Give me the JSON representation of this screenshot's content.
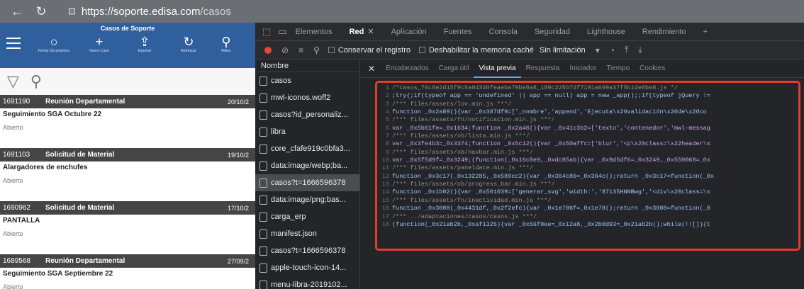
{
  "browser": {
    "url_host": "https://soporte.edisa.com",
    "url_path": "/casos",
    "back_icon": "back-arrow-icon",
    "reload_icon": "reload-icon",
    "lock_icon": "lock-icon"
  },
  "app": {
    "title": "Casos de Soporte",
    "tools": [
      {
        "label": "Firmar Documentos",
        "glyph": "○",
        "icon": "circle-icon"
      },
      {
        "label": "Nuevo Caso",
        "glyph": "+",
        "icon": "plus-icon"
      },
      {
        "label": "Exportar",
        "glyph": "⇪",
        "icon": "export-icon"
      },
      {
        "label": "Refrescar",
        "glyph": "↻",
        "icon": "refresh-icon"
      },
      {
        "label": "Filtros",
        "glyph": "⚲",
        "icon": "search-icon"
      }
    ],
    "filter_glyph": "▽",
    "search_glyph": "⚲",
    "cases": [
      {
        "id": "1691190",
        "type": "Reunión Departamental",
        "date": "20/10/2",
        "subject": "Seguimiento SGA Octubre 22",
        "status": "Abierto"
      },
      {
        "id": "1691103",
        "type": "Solicitud de Material",
        "date": "19/10/2",
        "subject": "Alargadores de enchufes",
        "status": "Abierto"
      },
      {
        "id": "1690962",
        "type": "Solicitud de Material",
        "date": "17/10/2",
        "subject": "PANTALLA",
        "status": "Abierto"
      },
      {
        "id": "1689568",
        "type": "Reunión Departamental",
        "date": "27/09/2",
        "subject": "Seguimiento SGA Septiembre 22",
        "status": "Abierto"
      }
    ]
  },
  "devtools": {
    "tabs": [
      "Elementos",
      "Red",
      "Aplicación",
      "Fuentes",
      "Consola",
      "Seguridad",
      "Lighthouse",
      "Rendimiento"
    ],
    "active_tab": "Red",
    "toolbar": {
      "preserve_log": "Conservar el registro",
      "disable_cache": "Deshabilitar la memoria caché",
      "throttling": "Sin limitación"
    },
    "names_header": "Nombre",
    "requests": [
      "casos",
      "mwl-iconos.woff2",
      "casos?id_personaliz...",
      "libra",
      "core_cfafe919c0bfa3...",
      "data:image/webp;ba...",
      "casos?t=1666596378",
      "data:image/png;bas...",
      "carga_erp",
      "manifest.json",
      "casos?t=1666596378",
      "apple-touch-icon-14...",
      "menu-libra-2019102..."
    ],
    "selected_request": 6,
    "detail_tabs": [
      "Encabezados",
      "Carga útil",
      "Vista previa",
      "Respuesta",
      "Iniciador",
      "Tiempo",
      "Cookies"
    ],
    "active_detail_tab": "Vista previa",
    "code_lines": [
      "/*casos_76c6e2d15f9c5a04340feaeba79be8a8_189c225b7df7191a669a37f5b1de8be8.js */",
      ";try{;if(typeof app == 'undefined' || app == null) app = new _app();;if(typeof jQuery !=",
      "/*** files/assets/lov.min.js ***/",
      "function _0x2a89(){var _0x387df9=['_nombre','append','Ejecuta\\x20validación\\x20de\\x20co",
      "/*** files/assets/fn/notificacion.min.js ***/",
      "var _0x5b61fe=_0x1634;function _0x2a46(){var _0x41c3b2=['texto','contenedor','mwl-messag",
      "/*** files/assets/ob/lista.min.js ***/",
      "var _0x3fe4b3=_0x3374;function _0x5c12(){var _0x50affc=['blur','<p\\x20class=\\x22header\\x",
      "/*** files/assets/ob/navbar.min.js ***/",
      "var _0x5f5d9f=_0x3249;(function(_0x16c8e9,_0xdc85ab){var _0x9d5df6=_0x3249,_0x550068=_0x",
      "/*** files/assets/paneldate.min.js ***/",
      "function _0x3c17(_0x132285,_0x589cc2){var _0x364c86=_0x364c();return _0x3c17=function(_0x",
      "/*** files/assets/ob/progress_bar.min.js ***/",
      "function _0x1b02(){var _0x501039=['generar_svg','width:','87135HNNBwg','<div\\x20class=\\x",
      "/*** files/assets/fn/inactividad.min.js ***/",
      "function _0x3008(_0x4431df,_0x2f2efc){var _0x1e786f=_0x1e78();return _0x3008=function(_0",
      "/*** ../adaptaciones/casos/casos.js ***/",
      "(function(_0x21ab2b,_0xaf1325){var _0x56f0ee=_0x12a8,_0x2b0d93=_0x21ab2b();while(!![]){t"
    ]
  }
}
